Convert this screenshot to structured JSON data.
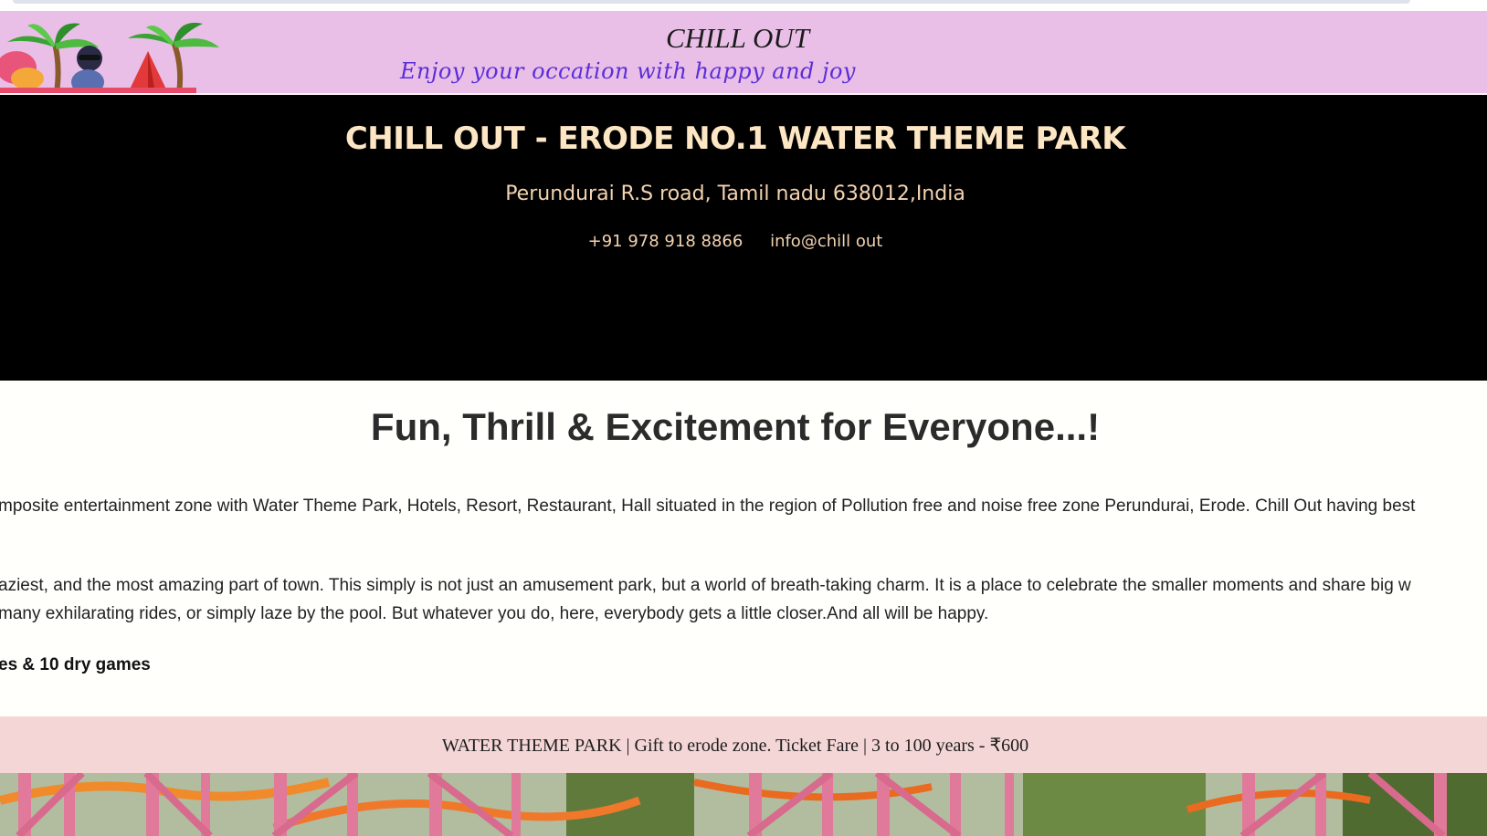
{
  "banner": {
    "title": "CHILL OUT",
    "subtitle": "Enjoy your occation with happy and joy"
  },
  "hero": {
    "title": "CHILL OUT - ERODE NO.1 WATER THEME PARK",
    "address": "Perundurai R.S road, Tamil nadu 638012,India",
    "phone": "+91 978 918 8866",
    "email": "info@chill out"
  },
  "content": {
    "heading": "Fun, Thrill & Excitement for Everyone...!",
    "paragraph_1": "mposite entertainment zone with Water Theme Park, Hotels, Resort, Restaurant, Hall situated in the region of Pollution free and noise free zone Perundurai, Erode. Chill Out having best",
    "paragraph_2_line_1": "aziest, and the most amazing part of town. This simply is not just an amusement park, but a world of breath-taking charm. It is a place to celebrate the smaller moments and share big w",
    "paragraph_2_line_2": "many exhilarating rides, or simply laze by the pool. But whatever you do, here, everybody gets a little closer.And all will be happy.",
    "highlight": "es & 10 dry games"
  },
  "fare_bar": {
    "text": "WATER THEME PARK | Gift to erode zone. Ticket Fare | 3 to 100 years - ₹600"
  },
  "colors": {
    "banner_bg": "#e9bfe7",
    "hero_bg": "#000000",
    "hero_text": "#fde6c4",
    "fare_bg": "#f4d6d6",
    "subtitle": "#5a2ed8"
  }
}
